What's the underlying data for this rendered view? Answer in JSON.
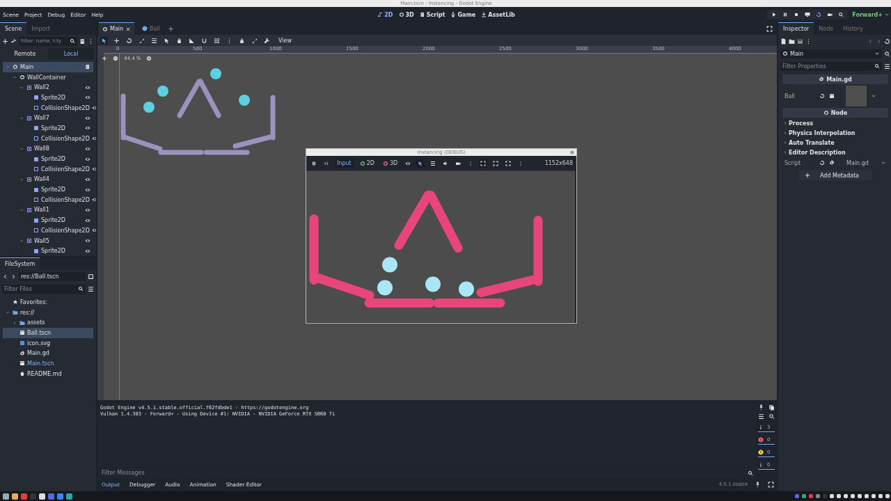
{
  "os_title": "Main.tscn - Instancing - Godot Engine",
  "menu": [
    "Scene",
    "Project",
    "Debug",
    "Editor",
    "Help"
  ],
  "workspaces": [
    {
      "label": "2D",
      "selected": true
    },
    {
      "label": "3D",
      "selected": false
    },
    {
      "label": "Script",
      "selected": false
    },
    {
      "label": "Game",
      "selected": false
    },
    {
      "label": "AssetLib",
      "selected": false
    }
  ],
  "renderer": "Forward+",
  "scene_dock": {
    "tabs": [
      {
        "label": "Scene",
        "selected": true
      },
      {
        "label": "Import",
        "selected": false
      }
    ],
    "filter_placeholder": "Filter: name, t:ty",
    "modes": [
      {
        "label": "Remote",
        "selected": false
      },
      {
        "label": "Local",
        "selected": true
      }
    ],
    "tree": [
      {
        "name": "Main",
        "kind": "root",
        "selected": true,
        "expanded": true,
        "children": [
          {
            "name": "WallContainer",
            "kind": "node",
            "selected": false,
            "expanded": true,
            "children": [
              {
                "name": "Wall2",
                "kind": "body",
                "selected": false,
                "expanded": true,
                "children": [
                  {
                    "name": "Sprite2D",
                    "kind": "sprite",
                    "selected": false
                  },
                  {
                    "name": "CollisionShape2D",
                    "kind": "shape",
                    "selected": false
                  }
                ]
              },
              {
                "name": "Wall7",
                "kind": "body",
                "selected": false,
                "expanded": true,
                "children": [
                  {
                    "name": "Sprite2D",
                    "kind": "sprite",
                    "selected": false
                  },
                  {
                    "name": "CollisionShape2D",
                    "kind": "shape",
                    "selected": false
                  }
                ]
              },
              {
                "name": "Wall8",
                "kind": "body",
                "selected": false,
                "expanded": true,
                "children": [
                  {
                    "name": "Sprite2D",
                    "kind": "sprite",
                    "selected": false
                  },
                  {
                    "name": "CollisionShape2D",
                    "kind": "shape",
                    "selected": false
                  }
                ]
              },
              {
                "name": "Wall4",
                "kind": "body",
                "selected": false,
                "expanded": true,
                "children": [
                  {
                    "name": "Sprite2D",
                    "kind": "sprite",
                    "selected": false
                  },
                  {
                    "name": "CollisionShape2D",
                    "kind": "shape",
                    "selected": false
                  }
                ]
              },
              {
                "name": "Wall1",
                "kind": "body",
                "selected": false,
                "expanded": true,
                "children": [
                  {
                    "name": "Sprite2D",
                    "kind": "sprite",
                    "selected": false
                  },
                  {
                    "name": "CollisionShape2D",
                    "kind": "shape",
                    "selected": false
                  }
                ]
              },
              {
                "name": "Wall5",
                "kind": "body",
                "selected": false,
                "expanded": true,
                "children": [
                  {
                    "name": "Sprite2D",
                    "kind": "sprite",
                    "selected": false
                  }
                ]
              }
            ]
          }
        ]
      }
    ]
  },
  "filesystem": {
    "title": "FileSystem",
    "path": "res://Ball.tscn",
    "filter_placeholder": "Filter Files",
    "favorites": "Favorites:",
    "tree": [
      {
        "name": "res://",
        "kind": "folder",
        "selected": false,
        "current": false,
        "expanded": true,
        "children": [
          {
            "name": "assets",
            "kind": "folder",
            "selected": false,
            "current": false,
            "expanded": false
          },
          {
            "name": "Ball.tscn",
            "kind": "scene",
            "selected": true,
            "current": false
          },
          {
            "name": "icon.svg",
            "kind": "image",
            "selected": false,
            "current": false
          },
          {
            "name": "Main.gd",
            "kind": "script",
            "selected": false,
            "current": false
          },
          {
            "name": "Main.tscn",
            "kind": "scene",
            "selected": false,
            "current": true
          },
          {
            "name": "README.md",
            "kind": "readme",
            "selected": false,
            "current": false
          }
        ]
      }
    ]
  },
  "editor_tabs": [
    {
      "label": "Main",
      "selected": true
    },
    {
      "label": "Ball",
      "selected": false
    }
  ],
  "view_menu": "View",
  "ruler_labels": [
    "0",
    "500",
    "1000",
    "1500",
    "2000",
    "2500",
    "3000",
    "3500",
    "4000"
  ],
  "zoom": "44.4 %",
  "game_window": {
    "title": "Instancing (DEBUG)",
    "input": {
      "label": "Input",
      "selected": true
    },
    "modes": [
      {
        "label": "2D",
        "color": "#7fd18b"
      },
      {
        "label": "3D",
        "color": "#ff7b8a"
      }
    ],
    "resolution": "1152x648"
  },
  "inspector": {
    "tabs": [
      {
        "label": "Inspector",
        "selected": true
      },
      {
        "label": "Node",
        "selected": false
      },
      {
        "label": "History",
        "selected": false
      }
    ],
    "object": "Main",
    "filter_placeholder": "Filter Properties",
    "script_section": "Main.gd",
    "property": "Ball",
    "node_section": "Node",
    "groups": [
      "Process",
      "Physics Interpolation",
      "Auto Translate",
      "Editor Description"
    ],
    "script_row": {
      "label": "Script",
      "value": "Main.gd"
    },
    "add_metadata": "Add Metadata"
  },
  "output": {
    "lines": [
      "Godot Engine v4.5.1.stable.official.f62fdbde1 - https://godotengine.org",
      "Vulkan 1.4.303 - Forward+ - Using Device #1: NVIDIA - NVIDIA GeForce RTX 5060 Ti"
    ],
    "filter_placeholder": "Filter Messages",
    "counters": [
      {
        "kind": "log",
        "count": "3"
      },
      {
        "kind": "error",
        "count": "0"
      },
      {
        "kind": "warning",
        "count": "0"
      },
      {
        "kind": "info",
        "count": "0"
      }
    ]
  },
  "bottom_tabs": [
    {
      "label": "Output",
      "selected": true
    },
    {
      "label": "Debugger",
      "selected": false
    },
    {
      "label": "Audio",
      "selected": false
    },
    {
      "label": "Animation",
      "selected": false
    },
    {
      "label": "Shader Editor",
      "selected": false
    }
  ],
  "version": "4.5.1.stable"
}
